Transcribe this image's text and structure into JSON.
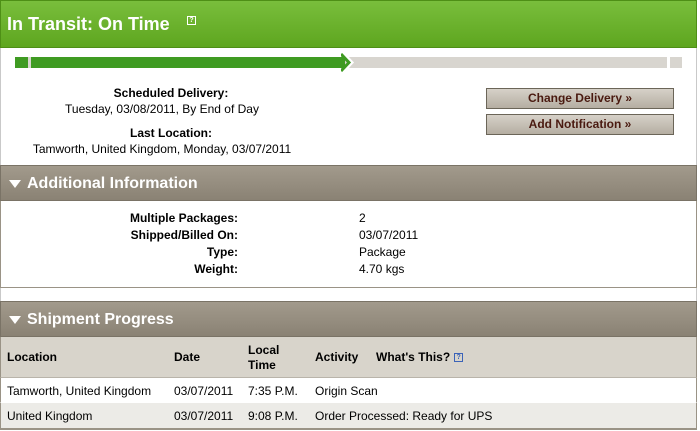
{
  "status": {
    "title": "In Transit: On Time",
    "help_icon": "help-icon",
    "progress_fraction": 0.49,
    "colors": {
      "header_green": "#6db32e",
      "progress_green": "#3f9b22",
      "track": "#d8d5cf"
    }
  },
  "delivery": {
    "scheduled_label": "Scheduled Delivery:",
    "scheduled_value": "Tuesday, 03/08/2011, By End of Day",
    "last_location_label": "Last Location:",
    "last_location_value": "Tamworth, United Kingdom, Monday, 03/07/2011"
  },
  "actions": {
    "change_delivery": "Change Delivery »",
    "add_notification": "Add Notification »"
  },
  "additional_info": {
    "title": "Additional Information",
    "rows": [
      {
        "label": "Multiple Packages:",
        "value": "2"
      },
      {
        "label": "Shipped/Billed On:",
        "value": "03/07/2011"
      },
      {
        "label": "Type:",
        "value": "Package"
      },
      {
        "label": "Weight:",
        "value": "4.70 kgs"
      }
    ]
  },
  "shipment_progress": {
    "title": "Shipment Progress",
    "columns": {
      "location": "Location",
      "date": "Date",
      "local_time_1": "Local",
      "local_time_2": "Time",
      "activity": "Activity",
      "whats_this": "What's This?"
    },
    "rows": [
      {
        "location": "Tamworth, United Kingdom",
        "date": "03/07/2011",
        "time": "7:35 P.M.",
        "activity": "Origin Scan"
      },
      {
        "location": "United Kingdom",
        "date": "03/07/2011",
        "time": "9:08 P.M.",
        "activity": "Order Processed: Ready for UPS"
      }
    ]
  }
}
